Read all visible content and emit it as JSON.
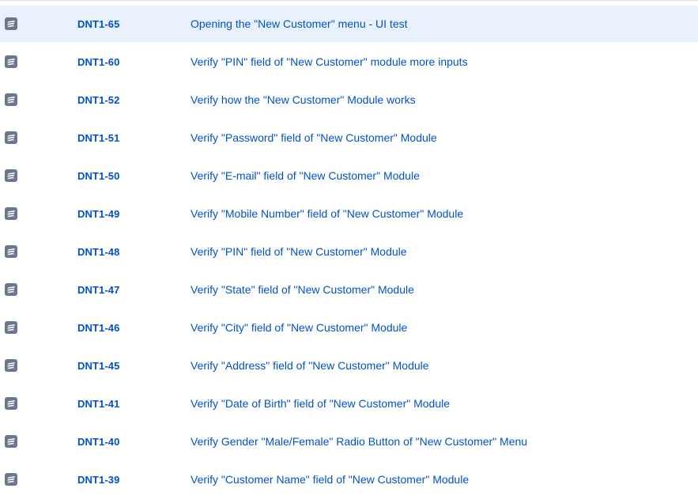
{
  "issues": [
    {
      "key": "DNT1-65",
      "summary": "Opening the \"New Customer\" menu - UI test",
      "icon": "test-issue-icon",
      "selected": true
    },
    {
      "key": "DNT1-60",
      "summary": "Verify \"PIN\" field of \"New Customer\" module more inputs",
      "icon": "test-issue-icon"
    },
    {
      "key": "DNT1-52",
      "summary": "Verify how the \"New Customer\" Module works",
      "icon": "test-issue-icon"
    },
    {
      "key": "DNT1-51",
      "summary": "Verify \"Password\" field of \"New Customer\" Module",
      "icon": "test-issue-icon"
    },
    {
      "key": "DNT1-50",
      "summary": "Verify \"E-mail\" field of \"New Customer\" Module",
      "icon": "test-issue-icon"
    },
    {
      "key": "DNT1-49",
      "summary": "Verify \"Mobile Number\" field of \"New Customer\" Module",
      "icon": "test-issue-icon"
    },
    {
      "key": "DNT1-48",
      "summary": "Verify \"PIN\" field of \"New Customer\" Module",
      "icon": "test-issue-icon"
    },
    {
      "key": "DNT1-47",
      "summary": "Verify \"State\" field of \"New Customer\" Module",
      "icon": "test-issue-icon"
    },
    {
      "key": "DNT1-46",
      "summary": "Verify \"City\" field of \"New Customer\" Module",
      "icon": "test-issue-icon"
    },
    {
      "key": "DNT1-45",
      "summary": "Verify \"Address\" field of \"New Customer\" Module",
      "icon": "test-issue-icon"
    },
    {
      "key": "DNT1-41",
      "summary": "Verify \"Date of Birth\" field of \"New Customer\" Module",
      "icon": "test-issue-icon"
    },
    {
      "key": "DNT1-40",
      "summary": "Verify Gender \"Male/Female\" Radio Button of \"New Customer\" Menu",
      "icon": "test-issue-icon"
    },
    {
      "key": "DNT1-39",
      "summary": "Verify \"Customer Name\" field of \"New Customer\" Module",
      "icon": "test-issue-icon"
    }
  ],
  "colors": {
    "link": "#0052cc",
    "selected_row": "#e9f1fd",
    "icon_bg": "#6b778c"
  }
}
